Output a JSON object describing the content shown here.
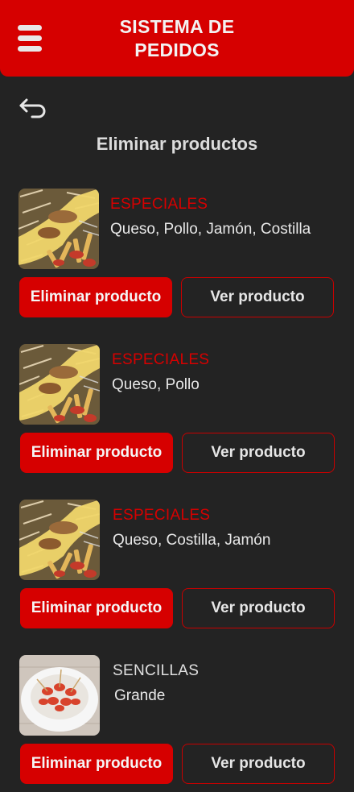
{
  "header": {
    "title_line1": "SISTEMA DE",
    "title_line2": "PEDIDOS",
    "menu_icon": "hamburger-menu-icon"
  },
  "nav": {
    "back_icon": "back-arrow-icon"
  },
  "page": {
    "title": "Eliminar productos"
  },
  "colors": {
    "accent": "#d60000",
    "background": "#232323"
  },
  "products": [
    {
      "category": "ESPECIALES",
      "category_color": "#d60000",
      "description": "Queso, Pollo, Jamón, Costilla",
      "delete_label": "Eliminar producto",
      "view_label": "Ver producto",
      "image": "fries-salchipapa"
    },
    {
      "category": "ESPECIALES",
      "category_color": "#d60000",
      "description": "Queso, Pollo",
      "delete_label": "Eliminar producto",
      "view_label": "Ver producto",
      "image": "fries-salchipapa"
    },
    {
      "category": "ESPECIALES",
      "category_color": "#d60000",
      "description": "Queso, Costilla, Jamón",
      "delete_label": "Eliminar producto",
      "view_label": "Ver producto",
      "image": "fries-salchipapa"
    },
    {
      "category": "SENCILLAS",
      "category_color": "#e0e0e0",
      "description": "Grande",
      "delete_label": "Eliminar producto",
      "view_label": "Ver producto",
      "image": "sausage-bowl"
    }
  ]
}
